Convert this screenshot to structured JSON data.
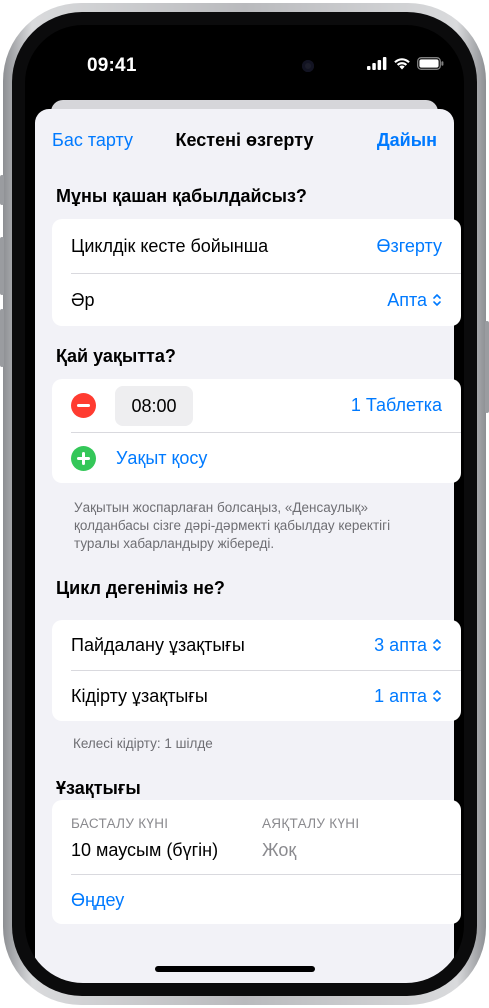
{
  "status_bar": {
    "time": "09:41"
  },
  "nav": {
    "cancel": "Бас тарту",
    "title": "Кестені өзгерту",
    "done": "Дайын"
  },
  "when": {
    "title": "Мұны қашан қабылдайсыз?",
    "schedule_label": "Циклдік кесте бойынша",
    "schedule_action": "Өзгерту",
    "every_label": "Әр",
    "every_value": "Апта"
  },
  "what_time": {
    "title": "Қай уақытта?",
    "time": "08:00",
    "dose": "1 Таблетка",
    "add_time": "Уақыт қосу",
    "footnote": "Уақытын жоспарлаған болсаңыз, «Денсаулық» қолданбасы сізге дәрі-дәрмекті қабылдау керектігі туралы хабарландыру жібереді."
  },
  "cycle": {
    "title": "Цикл дегеніміз не?",
    "usage_label": "Пайдалану ұзақтығы",
    "usage_value": "3 апта",
    "pause_label": "Кідірту ұзақтығы",
    "pause_value": "1 апта",
    "footnote": "Келесі кідірту: 1 шілде"
  },
  "duration": {
    "title": "Ұзақтығы",
    "start_label": "БАСТАЛУ КҮНІ",
    "start_value": "10 маусым (бүгін)",
    "end_label": "АЯҚТАЛУ КҮНІ",
    "end_value": "Жоқ",
    "edit": "Өңдеу"
  },
  "colors": {
    "accent": "#007aff",
    "destructive": "#ff3b30",
    "add": "#34c759",
    "background": "#f2f2f7"
  }
}
